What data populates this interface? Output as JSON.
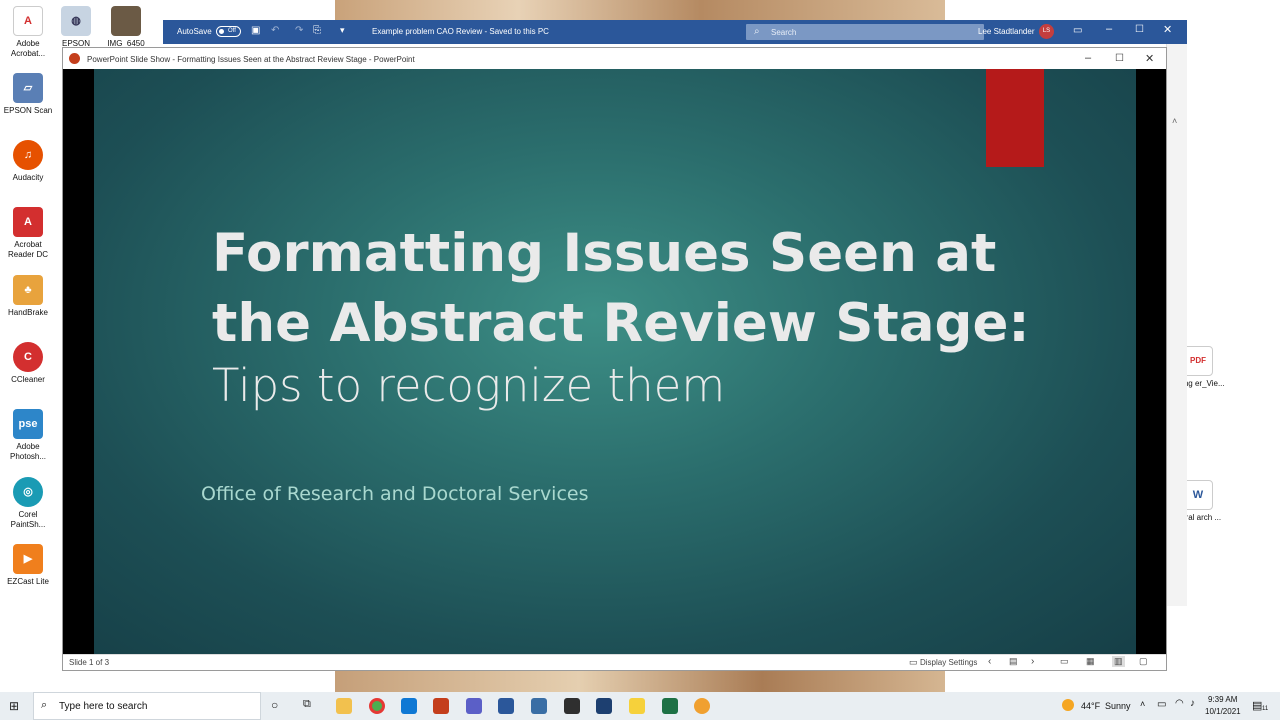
{
  "desktop": {
    "left_icons": [
      {
        "label": "Adobe Acrobat...",
        "icon": "acrobat-icon",
        "color": "#d32f2f"
      },
      {
        "label": "EPSON Scan",
        "icon": "scanner-icon",
        "color": "#5a7fb5"
      },
      {
        "label": "Audacity",
        "icon": "audacity-icon",
        "color": "#e65100"
      },
      {
        "label": "Acrobat Reader DC",
        "icon": "acrobat-reader-icon",
        "color": "#d32f2f"
      },
      {
        "label": "HandBrake",
        "icon": "handbrake-icon",
        "color": "#e8a33d"
      },
      {
        "label": "CCleaner",
        "icon": "ccleaner-icon",
        "color": "#d32f2f"
      },
      {
        "label": "Adobe Photosh...",
        "icon": "photoshop-elements-icon",
        "color": "#2d86c9"
      },
      {
        "label": "Corel PaintSh...",
        "icon": "corel-icon",
        "color": "#1a9bb4"
      },
      {
        "label": "EZCast Lite",
        "icon": "ezcast-icon",
        "color": "#f07f1d"
      }
    ],
    "top_icons": [
      {
        "label": "EPSON",
        "icon": "epson-icon"
      },
      {
        "label": "IMG_6450",
        "icon": "image-thumbnail-icon"
      }
    ],
    "right_icons": [
      {
        "label": "esting er_Vie...",
        "icon": "pdf-file-icon"
      },
      {
        "label": "ctoral arch ...",
        "icon": "word-file-icon"
      }
    ]
  },
  "word_window": {
    "autosave_label": "AutoSave",
    "autosave_state": "Off",
    "doc_title": "Example problem CAO Review  -  Saved to this PC",
    "search_placeholder": "Search",
    "user_name": "Lee Stadtlander",
    "user_initials": "LS"
  },
  "slideshow_window": {
    "title": "PowerPoint Slide Show  -  Formatting Issues Seen at the Abstract Review Stage - PowerPoint",
    "slide": {
      "title_line1": "Formatting Issues Seen at",
      "title_line2": "the Abstract Review Stage:",
      "subtitle": "Tips to recognize them",
      "organization": "Office of Research and Doctoral Services",
      "accent_color": "#b51a1a"
    },
    "status": {
      "slide_counter": "Slide 1 of 3",
      "display_settings": "Display Settings"
    }
  },
  "taskbar": {
    "search_placeholder": "Type here to search",
    "weather_temp": "44°F",
    "weather_text": "Sunny",
    "time": "9:39 AM",
    "date": "10/1/2021",
    "notification_count": "11"
  }
}
